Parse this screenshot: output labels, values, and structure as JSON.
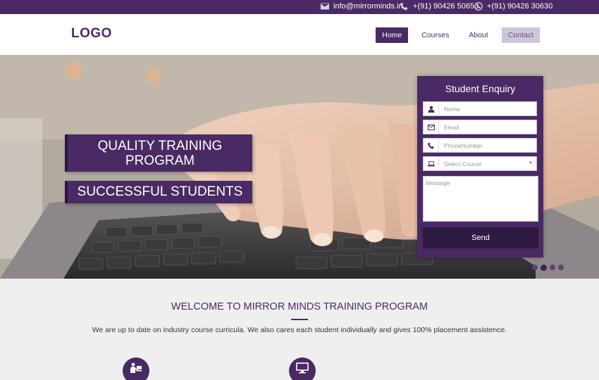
{
  "topbar": {
    "email": "info@mirrorminds.in",
    "phone": "+(91) 90426 50650",
    "whatsapp": "+(91) 90426 30630"
  },
  "header": {
    "logo": "LOGO",
    "nav": [
      {
        "label": "Home"
      },
      {
        "label": "Courses"
      },
      {
        "label": "About"
      },
      {
        "label": "Contact"
      }
    ]
  },
  "hero": {
    "headline": "QUALITY TRAINING PROGRAM",
    "subheadline": "SUCCESSFUL STUDENTS",
    "slider_count": 4,
    "slider_active_index": 1
  },
  "enquiry": {
    "title": "Student Enquiry",
    "name_placeholder": "Name",
    "email_placeholder": "Email",
    "phone_placeholder": "PhoneNumber",
    "course_placeholder": "Select Course",
    "message_placeholder": "Message",
    "submit_label": "Send"
  },
  "welcome": {
    "title": "WELCOME TO MIRROR MINDS TRAINING PROGRAM",
    "text": "We are up to date on industry course curricula. We also cares each student individually and gives 100% placement assistence."
  },
  "colors": {
    "brand": "#4a2a64",
    "brand_dark": "#2f1a44",
    "contact_bg": "#cfc5da",
    "section_bg": "#efefef"
  },
  "icons": [
    "envelope-icon",
    "phone-icon",
    "whatsapp-icon",
    "user-icon",
    "laptop-icon",
    "monitor-icon"
  ]
}
